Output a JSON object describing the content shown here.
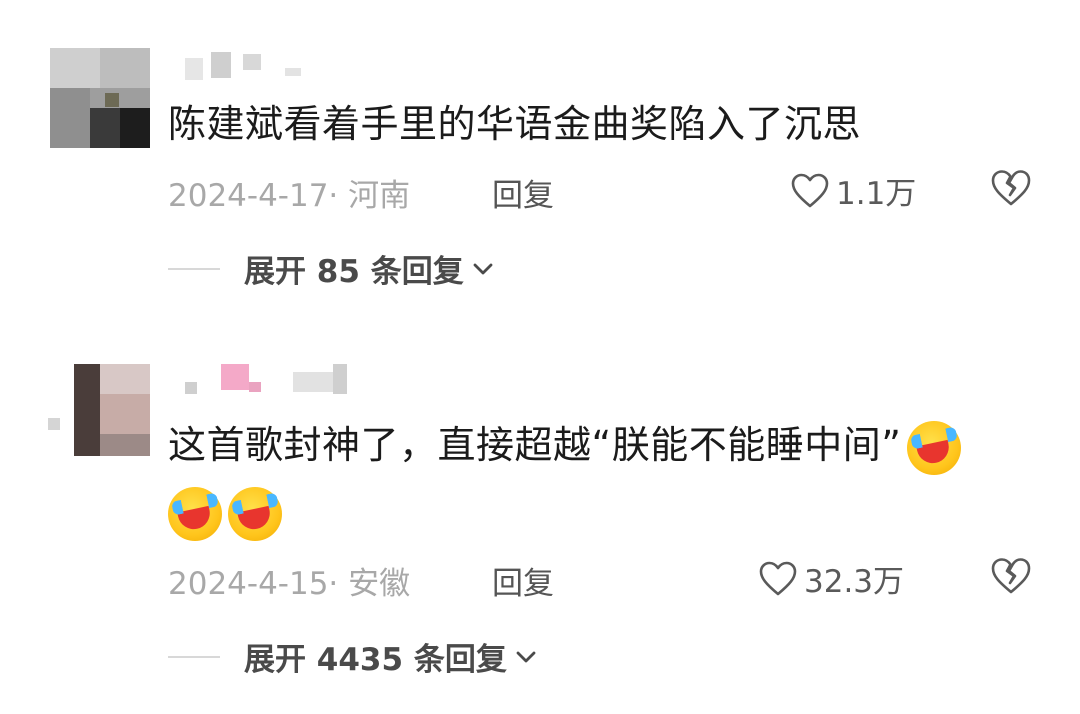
{
  "comments": [
    {
      "text": "陈建斌看着手里的华语金曲奖陷入了沉思",
      "date_location": "2024-4-17· 河南",
      "reply_label": "回复",
      "likes": "1.1万",
      "expand_label": "展开 85 条回复",
      "username_note": "blurred"
    },
    {
      "text": "这首歌封神了，直接超越“朕能不能睡中间”",
      "date_location": "2024-4-15· 安徽",
      "reply_label": "回复",
      "likes": "32.3万",
      "expand_label": "展开 4435 条回复",
      "username_note": "blurred"
    }
  ],
  "icons": {
    "like": "heart-outline-icon",
    "dislike": "broken-heart-icon",
    "chevron": "chevron-down-icon",
    "emoji": "tears-of-joy-emoji"
  },
  "colors": {
    "text": "#1b1b1b",
    "meta": "#a8a8a8",
    "action": "#555555"
  }
}
